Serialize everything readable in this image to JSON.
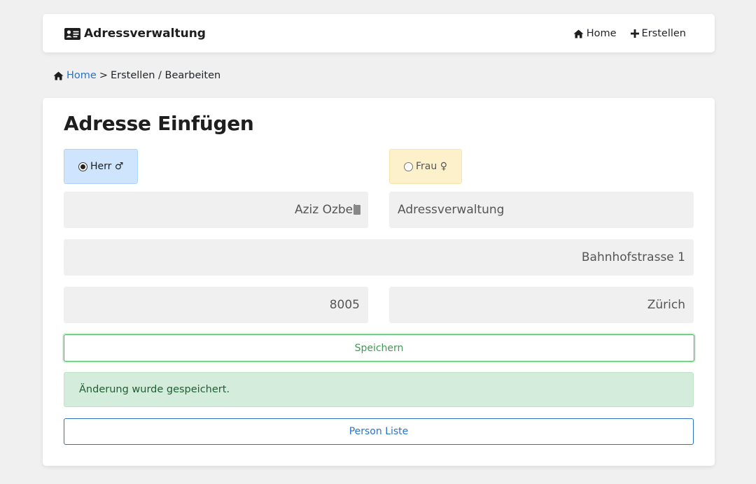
{
  "navbar": {
    "brand": "Adressverwaltung",
    "brand_icon": "address-card-icon",
    "links": [
      {
        "label": "Home",
        "icon": "home-icon"
      },
      {
        "label": "Erstellen",
        "icon": "plus-icon"
      }
    ]
  },
  "breadcrumb": {
    "home": "Home",
    "separator": ">",
    "current": "Erstellen / Bearbeiten"
  },
  "form": {
    "title": "Adresse Einfügen",
    "gender": {
      "herr": {
        "label": "Herr ♂",
        "selected": true,
        "color": "#cfe5fd"
      },
      "frau": {
        "label": "Frau ♀",
        "selected": false,
        "color": "#fdf1cb"
      }
    },
    "fields": {
      "name": "Aziz Ozbek",
      "company": "Adressverwaltung",
      "street": "Bahnhofstrasse 1",
      "zip": "8005",
      "city": "Zürich"
    },
    "save_label": "Speichern",
    "success_message": "Änderung wurde gespeichert.",
    "list_label": "Person Liste"
  },
  "colors": {
    "background": "#f0f0f0",
    "link": "#2a72c5",
    "success": "#4eae5f",
    "success_bg": "#d4ecdb"
  }
}
